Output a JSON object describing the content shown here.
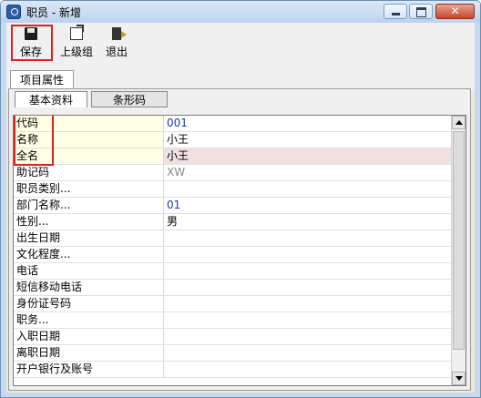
{
  "window": {
    "title": "职员 - 新增"
  },
  "toolbar": {
    "save": "保存",
    "parent_group": "上级组",
    "exit": "退出"
  },
  "tabs": {
    "main": "项目属性"
  },
  "subtabs": {
    "basic": "基本资料",
    "barcode": "条形码"
  },
  "colors": {
    "highlight_red": "#e0201c",
    "value_blue": "#1a3fa0"
  },
  "rows": [
    {
      "label": "代码",
      "value": "001"
    },
    {
      "label": "名称",
      "value": "小王"
    },
    {
      "label": "全名",
      "value": "小王"
    },
    {
      "label": "助记码",
      "value": "XW"
    },
    {
      "label": "职员类别...",
      "value": ""
    },
    {
      "label": "部门名称...",
      "value": "01"
    },
    {
      "label": "性别...",
      "value": "男"
    },
    {
      "label": "出生日期",
      "value": ""
    },
    {
      "label": "文化程度...",
      "value": ""
    },
    {
      "label": "电话",
      "value": ""
    },
    {
      "label": "短信移动电话",
      "value": ""
    },
    {
      "label": "身份证号码",
      "value": ""
    },
    {
      "label": "职务...",
      "value": ""
    },
    {
      "label": "入职日期",
      "value": ""
    },
    {
      "label": "离职日期",
      "value": ""
    },
    {
      "label": "开户银行及账号",
      "value": ""
    }
  ]
}
